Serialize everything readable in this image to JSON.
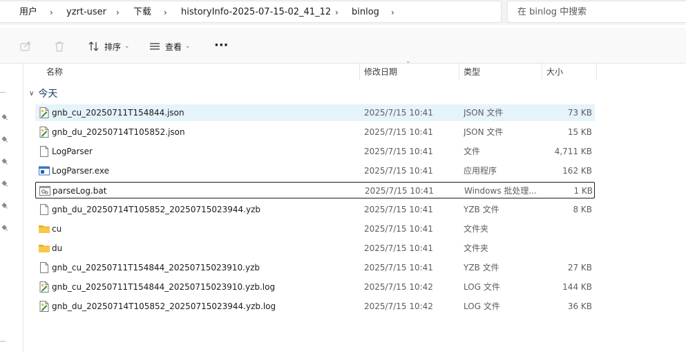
{
  "address_bar": {
    "crumbs": [
      "用户",
      "yzrt-user",
      "下载",
      "historyInfo-2025-07-15-02_41_12",
      "binlog"
    ],
    "separator": "›"
  },
  "search": {
    "placeholder": "在 binlog 中搜索"
  },
  "toolbar": {
    "share_icon": "share-icon",
    "delete_icon": "trash-icon",
    "sort_label": "排序",
    "view_label": "查看",
    "more_label": "···"
  },
  "columns": {
    "name": "名称",
    "date": "修改日期",
    "type": "类型",
    "size": "大小"
  },
  "group": {
    "label": "今天"
  },
  "files": [
    {
      "name": "gnb_cu_20250711T154844.json",
      "date": "2025/7/15 10:41",
      "type": "JSON 文件",
      "size": "73 KB",
      "icon": "json-file-icon"
    },
    {
      "name": "gnb_du_20250714T105852.json",
      "date": "2025/7/15 10:41",
      "type": "JSON 文件",
      "size": "15 KB",
      "icon": "json-file-icon"
    },
    {
      "name": "LogParser",
      "date": "2025/7/15 10:41",
      "type": "文件",
      "size": "4,711 KB",
      "icon": "blank-file-icon"
    },
    {
      "name": "LogParser.exe",
      "date": "2025/7/15 10:41",
      "type": "应用程序",
      "size": "162 KB",
      "icon": "exe-file-icon"
    },
    {
      "name": "parseLog.bat",
      "date": "2025/7/15 10:41",
      "type": "Windows 批处理...",
      "size": "1 KB",
      "icon": "bat-file-icon"
    },
    {
      "name": "gnb_du_20250714T105852_20250715023944.yzb",
      "date": "2025/7/15 10:41",
      "type": "YZB 文件",
      "size": "8 KB",
      "icon": "blank-file-icon"
    },
    {
      "name": "cu",
      "date": "2025/7/15 10:41",
      "type": "文件夹",
      "size": "",
      "icon": "folder-icon"
    },
    {
      "name": "du",
      "date": "2025/7/15 10:41",
      "type": "文件夹",
      "size": "",
      "icon": "folder-icon"
    },
    {
      "name": "gnb_cu_20250711T154844_20250715023910.yzb",
      "date": "2025/7/15 10:41",
      "type": "YZB 文件",
      "size": "27 KB",
      "icon": "blank-file-icon"
    },
    {
      "name": "gnb_cu_20250711T154844_20250715023910.yzb.log",
      "date": "2025/7/15 10:42",
      "type": "LOG 文件",
      "size": "144 KB",
      "icon": "log-file-icon"
    },
    {
      "name": "gnb_du_20250714T105852_20250715023944.yzb.log",
      "date": "2025/7/15 10:42",
      "type": "LOG 文件",
      "size": "36 KB",
      "icon": "log-file-icon"
    }
  ],
  "colors": {
    "hover_row": "#e5f3fb",
    "folder": "#f8c846",
    "group_text": "#1f3b6b"
  }
}
